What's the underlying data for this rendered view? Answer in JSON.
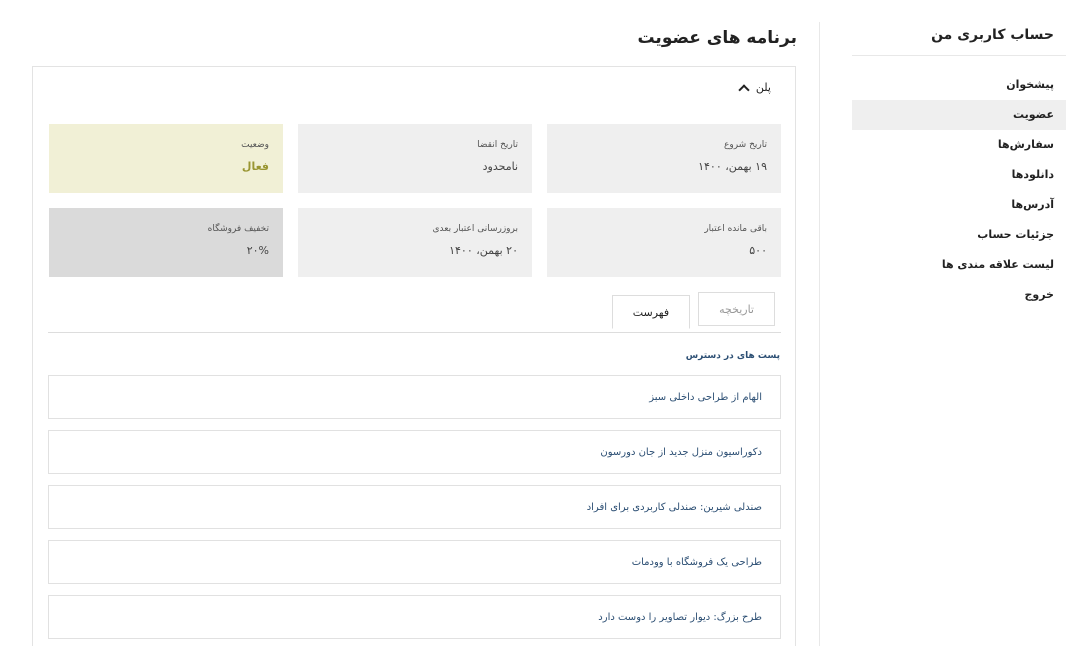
{
  "sidebar": {
    "title": "حساب کاربری من",
    "items": [
      {
        "label": "پیشخوان",
        "active": false
      },
      {
        "label": "عضویت",
        "active": true
      },
      {
        "label": "سفارش‌ها",
        "active": false
      },
      {
        "label": "دانلودها",
        "active": false
      },
      {
        "label": "آدرس‌ها",
        "active": false
      },
      {
        "label": "جزئیات حساب",
        "active": false
      },
      {
        "label": "لیست علاقه مندی ها",
        "active": false
      },
      {
        "label": "خروج",
        "active": false
      }
    ]
  },
  "main": {
    "title": "برنامه های عضویت",
    "plan_label": "پلن",
    "cards": [
      {
        "label": "تاریخ شروع",
        "value": "۱۹ بهمن، ۱۴۰۰"
      },
      {
        "label": "تاریخ انقضا",
        "value": "نامحدود"
      },
      {
        "label": "وضعیت",
        "value": "فعال"
      },
      {
        "label": "باقی مانده اعتبار",
        "value": "۵۰۰"
      },
      {
        "label": "بروزرسانی اعتبار بعدی",
        "value": "۲۰ بهمن، ۱۴۰۰"
      },
      {
        "label": "تخفیف فروشگاه",
        "value": "۲۰%"
      }
    ],
    "tabs": [
      {
        "label": "تاریخچه"
      },
      {
        "label": "فهرست"
      }
    ],
    "posts_title": "پست های در دسترس",
    "posts": [
      "الهام از طراحی داخلی سبز",
      "دکوراسیون منزل جدید از جان دورسون",
      "صندلی شیرین: صندلی کاربردی برای افراد",
      "طراحی یک فروشگاه با وودمات",
      "طرح بزرگ: دیوار تصاویر را دوست دارد"
    ]
  },
  "colors": {
    "status_bg": "#f1f0d6",
    "status_text": "#9a9632",
    "link": "#2b4e73"
  }
}
